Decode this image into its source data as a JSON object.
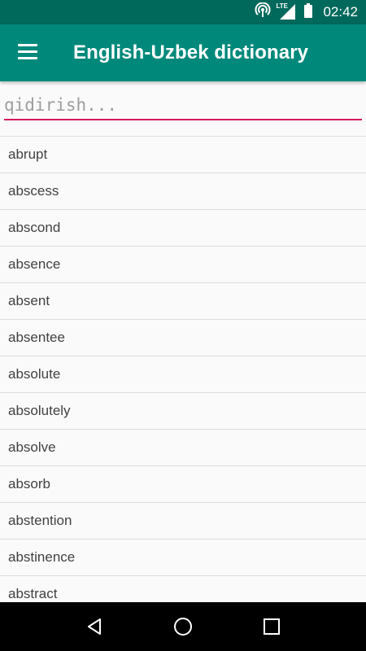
{
  "status_bar": {
    "time": "02:42",
    "network_label": "LTE",
    "icons": [
      "hotspot-icon",
      "lte-signal-icon",
      "battery-icon"
    ],
    "background": "#00695c"
  },
  "app_bar": {
    "title": "English-Uzbek dictionary",
    "menu_icon": "hamburger-menu-icon",
    "background": "#00897b"
  },
  "search": {
    "placeholder": "qidirish...",
    "value": "",
    "underline_color": "#d81b60"
  },
  "words": [
    "abrupt",
    "abscess",
    "abscond",
    "absence",
    "absent",
    "absentee",
    "absolute",
    "absolutely",
    "absolve",
    "absorb",
    "abstention",
    "abstinence",
    "abstract"
  ],
  "nav_bar": {
    "icons": [
      "back-icon",
      "home-icon",
      "recents-icon"
    ]
  }
}
